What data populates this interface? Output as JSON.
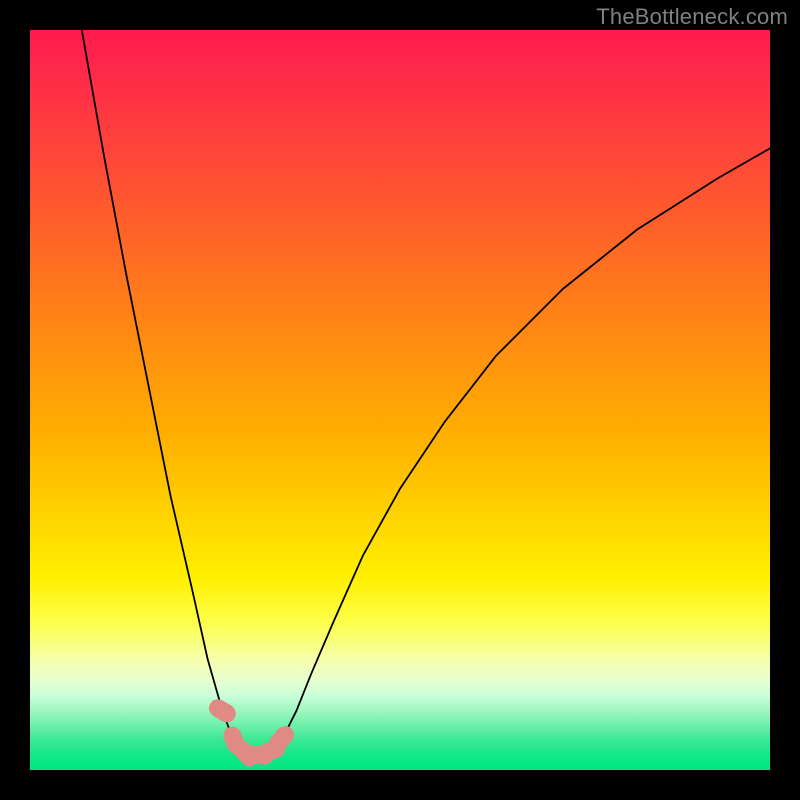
{
  "watermark": "TheBottleneck.com",
  "chart_data": {
    "type": "line",
    "title": "",
    "xlabel": "",
    "ylabel": "",
    "xlim": [
      0,
      100
    ],
    "ylim": [
      0,
      100
    ],
    "grid": false,
    "series": [
      {
        "name": "curve",
        "x": [
          7,
          10,
          13,
          16,
          19,
          22,
          24,
          26,
          27.5,
          29,
          30,
          31,
          32,
          33,
          34,
          36,
          38,
          41,
          45,
          50,
          56,
          63,
          72,
          82,
          93,
          100
        ],
        "y": [
          100,
          83,
          67,
          52,
          37,
          24,
          15,
          8,
          4,
          2.2,
          2,
          2,
          2,
          2.5,
          4,
          8,
          13,
          20,
          29,
          38,
          47,
          56,
          65,
          73,
          80,
          84
        ]
      }
    ],
    "markers": {
      "name": "highlight-points",
      "color": "#e08a85",
      "x": [
        26.0,
        27.6,
        29.2,
        31.0,
        32.6,
        34.0
      ],
      "y": [
        8.0,
        4.0,
        2.2,
        2.0,
        2.6,
        4.2
      ]
    },
    "background": "gradient red-yellow-green (bottleneck heatmap)"
  }
}
